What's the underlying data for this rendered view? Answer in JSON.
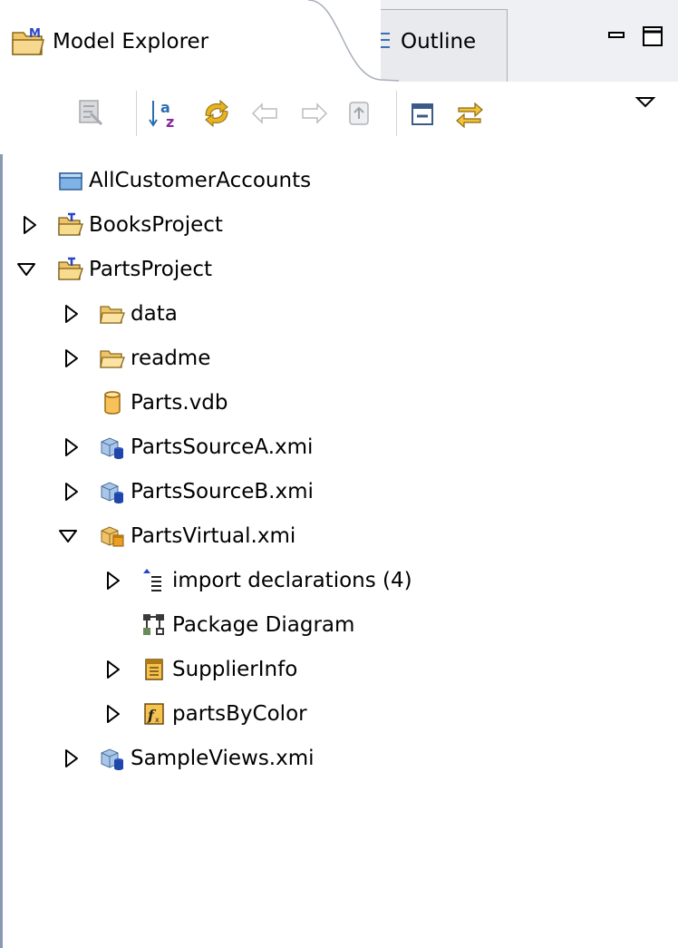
{
  "tabs": [
    {
      "label": "Model Explorer",
      "icon": "model-explorer-icon",
      "active": true
    },
    {
      "label": "Outline",
      "icon": "outline-icon",
      "active": false
    }
  ],
  "window_controls": {
    "minimize": "minimize-icon",
    "maximize": "maximize-icon"
  },
  "toolbar": [
    {
      "name": "filter-icon",
      "enabled": false
    },
    {
      "name": "sort-az-icon",
      "enabled": true
    },
    {
      "name": "sync-icon",
      "enabled": true
    },
    {
      "name": "back-arrow-icon",
      "enabled": false
    },
    {
      "name": "forward-arrow-icon",
      "enabled": false
    },
    {
      "name": "up-folder-icon",
      "enabled": false
    },
    {
      "name": "collapse-all-icon",
      "enabled": true
    },
    {
      "name": "link-with-editor-icon",
      "enabled": true
    },
    {
      "name": "view-menu-icon",
      "enabled": true
    }
  ],
  "tree": [
    {
      "label": "AllCustomerAccounts",
      "level": 0,
      "twisty": "none",
      "icon": "closed-project-icon"
    },
    {
      "label": "BooksProject",
      "level": 0,
      "twisty": "collapsed",
      "icon": "model-project-icon"
    },
    {
      "label": "PartsProject",
      "level": 0,
      "twisty": "expanded",
      "icon": "model-project-icon"
    },
    {
      "label": "data",
      "level": 1,
      "twisty": "collapsed",
      "icon": "folder-icon"
    },
    {
      "label": "readme",
      "level": 1,
      "twisty": "collapsed",
      "icon": "folder-icon"
    },
    {
      "label": "Parts.vdb",
      "level": 1,
      "twisty": "none",
      "icon": "vdb-icon"
    },
    {
      "label": "PartsSourceA.xmi",
      "level": 1,
      "twisty": "collapsed",
      "icon": "source-model-icon"
    },
    {
      "label": "PartsSourceB.xmi",
      "level": 1,
      "twisty": "collapsed",
      "icon": "source-model-icon"
    },
    {
      "label": "PartsVirtual.xmi",
      "level": 1,
      "twisty": "expanded",
      "icon": "virtual-model-icon"
    },
    {
      "label": "import declarations (4)",
      "level": 2,
      "twisty": "collapsed",
      "icon": "import-declarations-icon"
    },
    {
      "label": "Package Diagram",
      "level": 2,
      "twisty": "none",
      "icon": "package-diagram-icon"
    },
    {
      "label": "SupplierInfo",
      "level": 2,
      "twisty": "collapsed",
      "icon": "table-icon"
    },
    {
      "label": "partsByColor",
      "level": 2,
      "twisty": "collapsed",
      "icon": "procedure-icon"
    },
    {
      "label": "SampleViews.xmi",
      "level": 1,
      "twisty": "collapsed",
      "icon": "source-model-icon"
    }
  ]
}
